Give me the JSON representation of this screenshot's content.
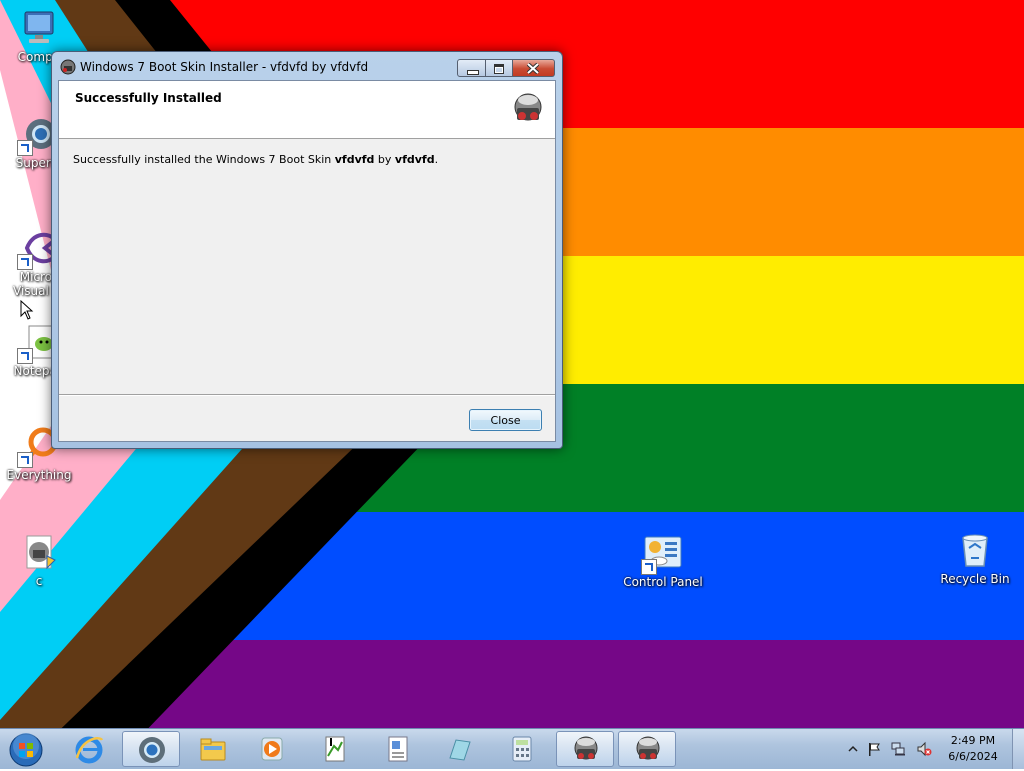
{
  "window": {
    "title": "Windows 7 Boot Skin Installer - vfdvfd by vfdvfd",
    "header_title": "Successfully Installed",
    "message_prefix": "Successfully installed the Windows 7 Boot Skin ",
    "skin_name": "vfdvfd",
    "message_by": " by ",
    "author_name": "vfdvfd",
    "message_suffix": ".",
    "close_label": "Close"
  },
  "desktop_icons": {
    "computer": "Compu",
    "supermium": "Superm",
    "visual_studio_line1": "Micros",
    "visual_studio_line2": "Visual St",
    "notepad": "Notepad",
    "everything": "Everything",
    "c": "c",
    "control_panel": "Control Panel",
    "recycle_bin": "Recycle Bin"
  },
  "taskbar": {
    "items": [
      "start-orb",
      "internet-explorer",
      "chrome",
      "file-explorer",
      "media-player",
      "notepad-plus-plus",
      "wordpad",
      "generic-app",
      "calculator",
      "boot-skin-installer",
      "boot-skin-installer"
    ],
    "clock_time": "2:49 PM",
    "clock_date": "6/6/2024"
  },
  "colors": {
    "flag_red": "#FF0000",
    "flag_orange": "#FF8C00",
    "flag_yellow": "#FFED00",
    "flag_green": "#008026",
    "flag_blue": "#004DFF",
    "flag_purple": "#750787",
    "chevron_white": "#FFFFFF",
    "chevron_pink": "#FFAFC8",
    "chevron_cyan": "#00CEF5",
    "chevron_brown": "#613915",
    "chevron_black": "#000000"
  }
}
